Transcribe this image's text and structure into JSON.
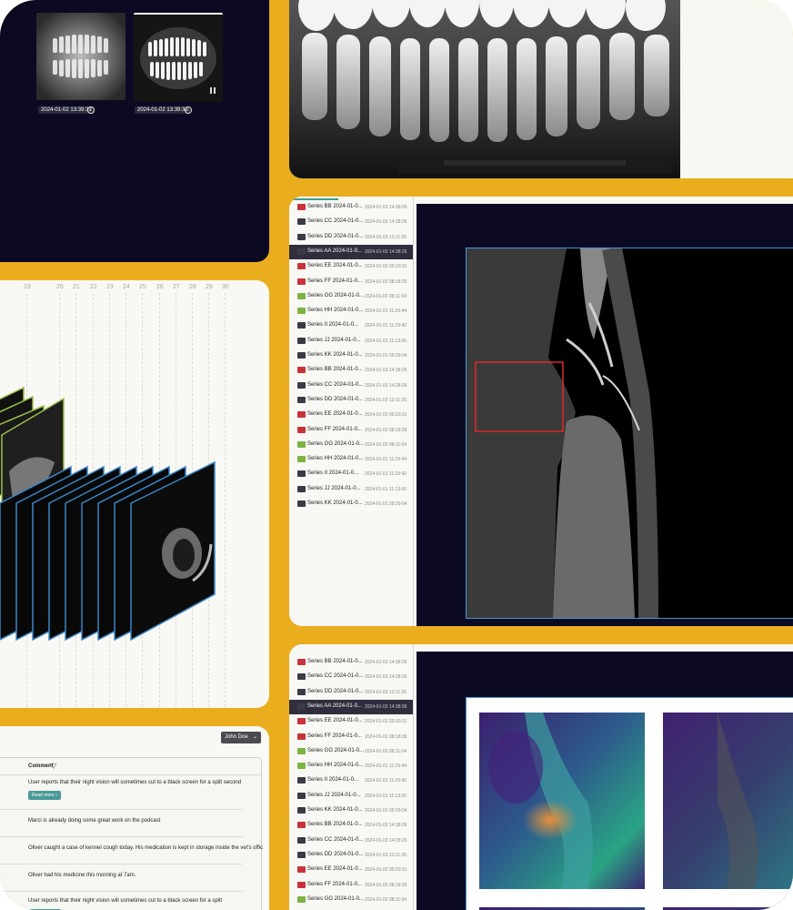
{
  "thumbnails": [
    {
      "timestamp": "2024-01-02 13:39:31"
    },
    {
      "timestamp": "2024-01-02 13:39:31"
    }
  ],
  "timeline": {
    "ticks": [
      "19",
      "20",
      "21",
      "22",
      "23",
      "24",
      "25",
      "26",
      "27",
      "28",
      "29",
      "30"
    ]
  },
  "series_lists": [
    {
      "selected_index": 3,
      "items": [
        {
          "name": "Series BB 2024-01-0...",
          "time": "2024-01-03 14:38:26",
          "icon_color": "#c7333a"
        },
        {
          "name": "Series CC 2024-01-0...",
          "time": "2024-01-03 14:28:26",
          "icon_color": "#3b3b46"
        },
        {
          "name": "Series DD 2024-01-0...",
          "time": "2024-01-03 13:11:26",
          "icon_color": "#3b3b46"
        },
        {
          "name": "Series AA 2024-01-0...",
          "time": "2024-01-03 14:38:26",
          "icon_color": "#3b3b46"
        },
        {
          "name": "Series EE 2024-01-0...",
          "time": "2024-01-02 00:20:31",
          "icon_color": "#c7333a"
        },
        {
          "name": "Series FF 2024-01-0...",
          "time": "2024-01-02 08:18:39",
          "icon_color": "#c7333a"
        },
        {
          "name": "Series GG 2024-01-0...",
          "time": "2024-01-02 08:11:04",
          "icon_color": "#7cb342"
        },
        {
          "name": "Series HH 2024-01-0...",
          "time": "2024-01-01 11:29:44",
          "icon_color": "#7cb342"
        },
        {
          "name": "Series II 2024-01-0...",
          "time": "2024-01-01 11:29:42",
          "icon_color": "#3b3b46"
        },
        {
          "name": "Series JJ 2024-01-0...",
          "time": "2024-01-01 11:13:06",
          "icon_color": "#3b3b46"
        },
        {
          "name": "Series KK 2024-01-0...",
          "time": "2024-01-01 09:29:04",
          "icon_color": "#3b3b46"
        },
        {
          "name": "Series BB 2024-01-0...",
          "time": "2024-01-03 14:38:26",
          "icon_color": "#c7333a"
        },
        {
          "name": "Series CC 2024-01-0...",
          "time": "2024-01-03 14:28:26",
          "icon_color": "#3b3b46"
        },
        {
          "name": "Series DD 2024-01-0...",
          "time": "2024-01-03 13:11:26",
          "icon_color": "#3b3b46"
        },
        {
          "name": "Series EE 2024-01-0...",
          "time": "2024-01-02 00:20:31",
          "icon_color": "#c7333a"
        },
        {
          "name": "Series FF 2024-01-0...",
          "time": "2024-01-02 08:18:39",
          "icon_color": "#c7333a"
        },
        {
          "name": "Series GG 2024-01-0...",
          "time": "2024-01-02 08:11:04",
          "icon_color": "#7cb342"
        },
        {
          "name": "Series HH 2024-01-0...",
          "time": "2024-01-01 11:29:44",
          "icon_color": "#7cb342"
        },
        {
          "name": "Series II 2024-01-0...",
          "time": "2024-01-01 11:29:42",
          "icon_color": "#3b3b46"
        },
        {
          "name": "Series JJ 2024-01-0...",
          "time": "2024-01-01 11:13:06",
          "icon_color": "#3b3b46"
        },
        {
          "name": "Series KK 2024-01-0...",
          "time": "2024-01-01 09:29:04",
          "icon_color": "#3b3b46"
        }
      ]
    },
    {
      "selected_index": 3,
      "items": [
        {
          "name": "Series BB 2024-01-0...",
          "time": "2024-01-03 14:38:26",
          "icon_color": "#c7333a"
        },
        {
          "name": "Series CC 2024-01-0...",
          "time": "2024-01-03 14:28:26",
          "icon_color": "#3b3b46"
        },
        {
          "name": "Series DD 2024-01-0...",
          "time": "2024-01-03 13:11:26",
          "icon_color": "#3b3b46"
        },
        {
          "name": "Series AA 2024-01-0...",
          "time": "2024-01-03 14:38:26",
          "icon_color": "#3b3b46"
        },
        {
          "name": "Series EE 2024-01-0...",
          "time": "2024-01-02 00:20:31",
          "icon_color": "#c7333a"
        },
        {
          "name": "Series FF 2024-01-0...",
          "time": "2024-01-02 08:18:39",
          "icon_color": "#c7333a"
        },
        {
          "name": "Series GG 2024-01-0...",
          "time": "2024-01-02 08:11:04",
          "icon_color": "#7cb342"
        },
        {
          "name": "Series HH 2024-01-0...",
          "time": "2024-01-01 11:29:44",
          "icon_color": "#7cb342"
        },
        {
          "name": "Series II 2024-01-0...",
          "time": "2024-01-01 11:29:42",
          "icon_color": "#3b3b46"
        },
        {
          "name": "Series JJ 2024-01-0...",
          "time": "2024-01-01 11:13:06",
          "icon_color": "#3b3b46"
        },
        {
          "name": "Series KK 2024-01-0...",
          "time": "2024-01-01 09:29:04",
          "icon_color": "#3b3b46"
        },
        {
          "name": "Series BB 2024-01-0...",
          "time": "2024-01-03 14:38:26",
          "icon_color": "#c7333a"
        },
        {
          "name": "Series CC 2024-01-0...",
          "time": "2024-01-03 14:28:26",
          "icon_color": "#3b3b46"
        },
        {
          "name": "Series DD 2024-01-0...",
          "time": "2024-01-03 13:11:26",
          "icon_color": "#3b3b46"
        },
        {
          "name": "Series EE 2024-01-0...",
          "time": "2024-01-02 00:20:31",
          "icon_color": "#c7333a"
        },
        {
          "name": "Series FF 2024-01-0...",
          "time": "2024-01-02 08:18:39",
          "icon_color": "#c7333a"
        },
        {
          "name": "Series GG 2024-01-0...",
          "time": "2024-01-02 08:11:04",
          "icon_color": "#7cb342"
        }
      ]
    }
  ],
  "comments": {
    "user_select": "John Doe",
    "column_header": "Comment",
    "read_more_label": "Read more",
    "rows": [
      {
        "text": "User reports that their night vision will sometimes cut to a black screen for a split second",
        "has_read_more": true
      },
      {
        "text": "Marci is already doing some great work on the podcast",
        "has_read_more": false
      },
      {
        "text": "Oliver caught a case of kennel cough today. His medication is kept in storage inside the vet's offic",
        "has_read_more": false
      },
      {
        "text": "Oliver had his medicine this morning at 7am.",
        "has_read_more": false
      },
      {
        "text": "User reports that their night vision will sometimes cut to a black screen for a split",
        "has_read_more": true
      }
    ]
  }
}
